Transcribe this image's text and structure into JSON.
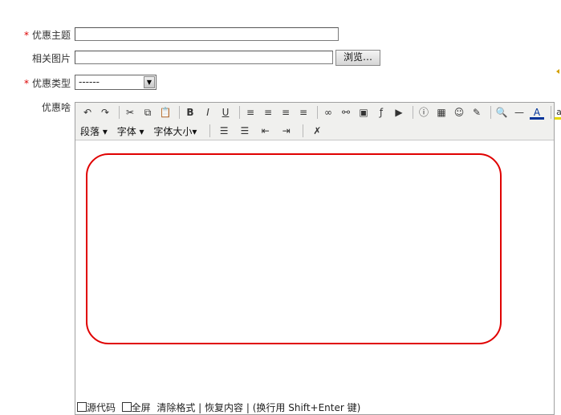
{
  "form": {
    "subject": {
      "required_mark": "*",
      "label": "优惠主题",
      "value": ""
    },
    "image": {
      "label": "相关图片",
      "value": "",
      "browse_label": "浏览…"
    },
    "type": {
      "required_mark": "*",
      "label": "优惠类型",
      "selected": "------"
    },
    "content": {
      "label": "优惠啥"
    }
  },
  "editor": {
    "toolbar_row1": [
      {
        "name": "undo-icon",
        "glyph": "↶"
      },
      {
        "name": "redo-icon",
        "glyph": "↷"
      },
      {
        "name": "cut-icon",
        "glyph": "✂"
      },
      {
        "name": "copy-icon",
        "glyph": "⧉"
      },
      {
        "name": "paste-icon",
        "glyph": "📋"
      },
      {
        "name": "bold-icon",
        "glyph": "B"
      },
      {
        "name": "italic-icon",
        "glyph": "I"
      },
      {
        "name": "underline-icon",
        "glyph": "U"
      },
      {
        "name": "align-left-icon",
        "glyph": "≡"
      },
      {
        "name": "align-center-icon",
        "glyph": "≡"
      },
      {
        "name": "align-right-icon",
        "glyph": "≡"
      },
      {
        "name": "align-justify-icon",
        "glyph": "≡"
      },
      {
        "name": "link-icon",
        "glyph": "∞"
      },
      {
        "name": "unlink-icon",
        "glyph": "⚯"
      },
      {
        "name": "image-icon",
        "glyph": "▣"
      },
      {
        "name": "flash-icon",
        "glyph": "ƒ"
      },
      {
        "name": "media-icon",
        "glyph": "▶"
      },
      {
        "name": "info-icon",
        "glyph": "ⓘ"
      },
      {
        "name": "table-icon",
        "glyph": "▦"
      },
      {
        "name": "emoticon-icon",
        "glyph": "☺"
      },
      {
        "name": "note-icon",
        "glyph": "✎"
      },
      {
        "name": "search-icon",
        "glyph": "🔍"
      },
      {
        "name": "horizontal-rule-icon",
        "glyph": "—"
      },
      {
        "name": "font-color-icon",
        "glyph": "A"
      },
      {
        "name": "highlight-icon",
        "glyph": "ab"
      }
    ],
    "toolbar_row2": {
      "paragraph_label": "段落",
      "font_label": "字体",
      "font_size_label": "字体大小"
    },
    "status_bar": {
      "source_label": "源代码",
      "fullscreen_label": "全屏",
      "clear_format_label": "清除格式",
      "sep1": "|",
      "restore_label": "恢复内容",
      "sep2": "|",
      "hint": "(换行用 Shift+Enter 键)"
    }
  },
  "colors": {
    "required": "#dd0000",
    "highlight_border": "#e00000"
  }
}
